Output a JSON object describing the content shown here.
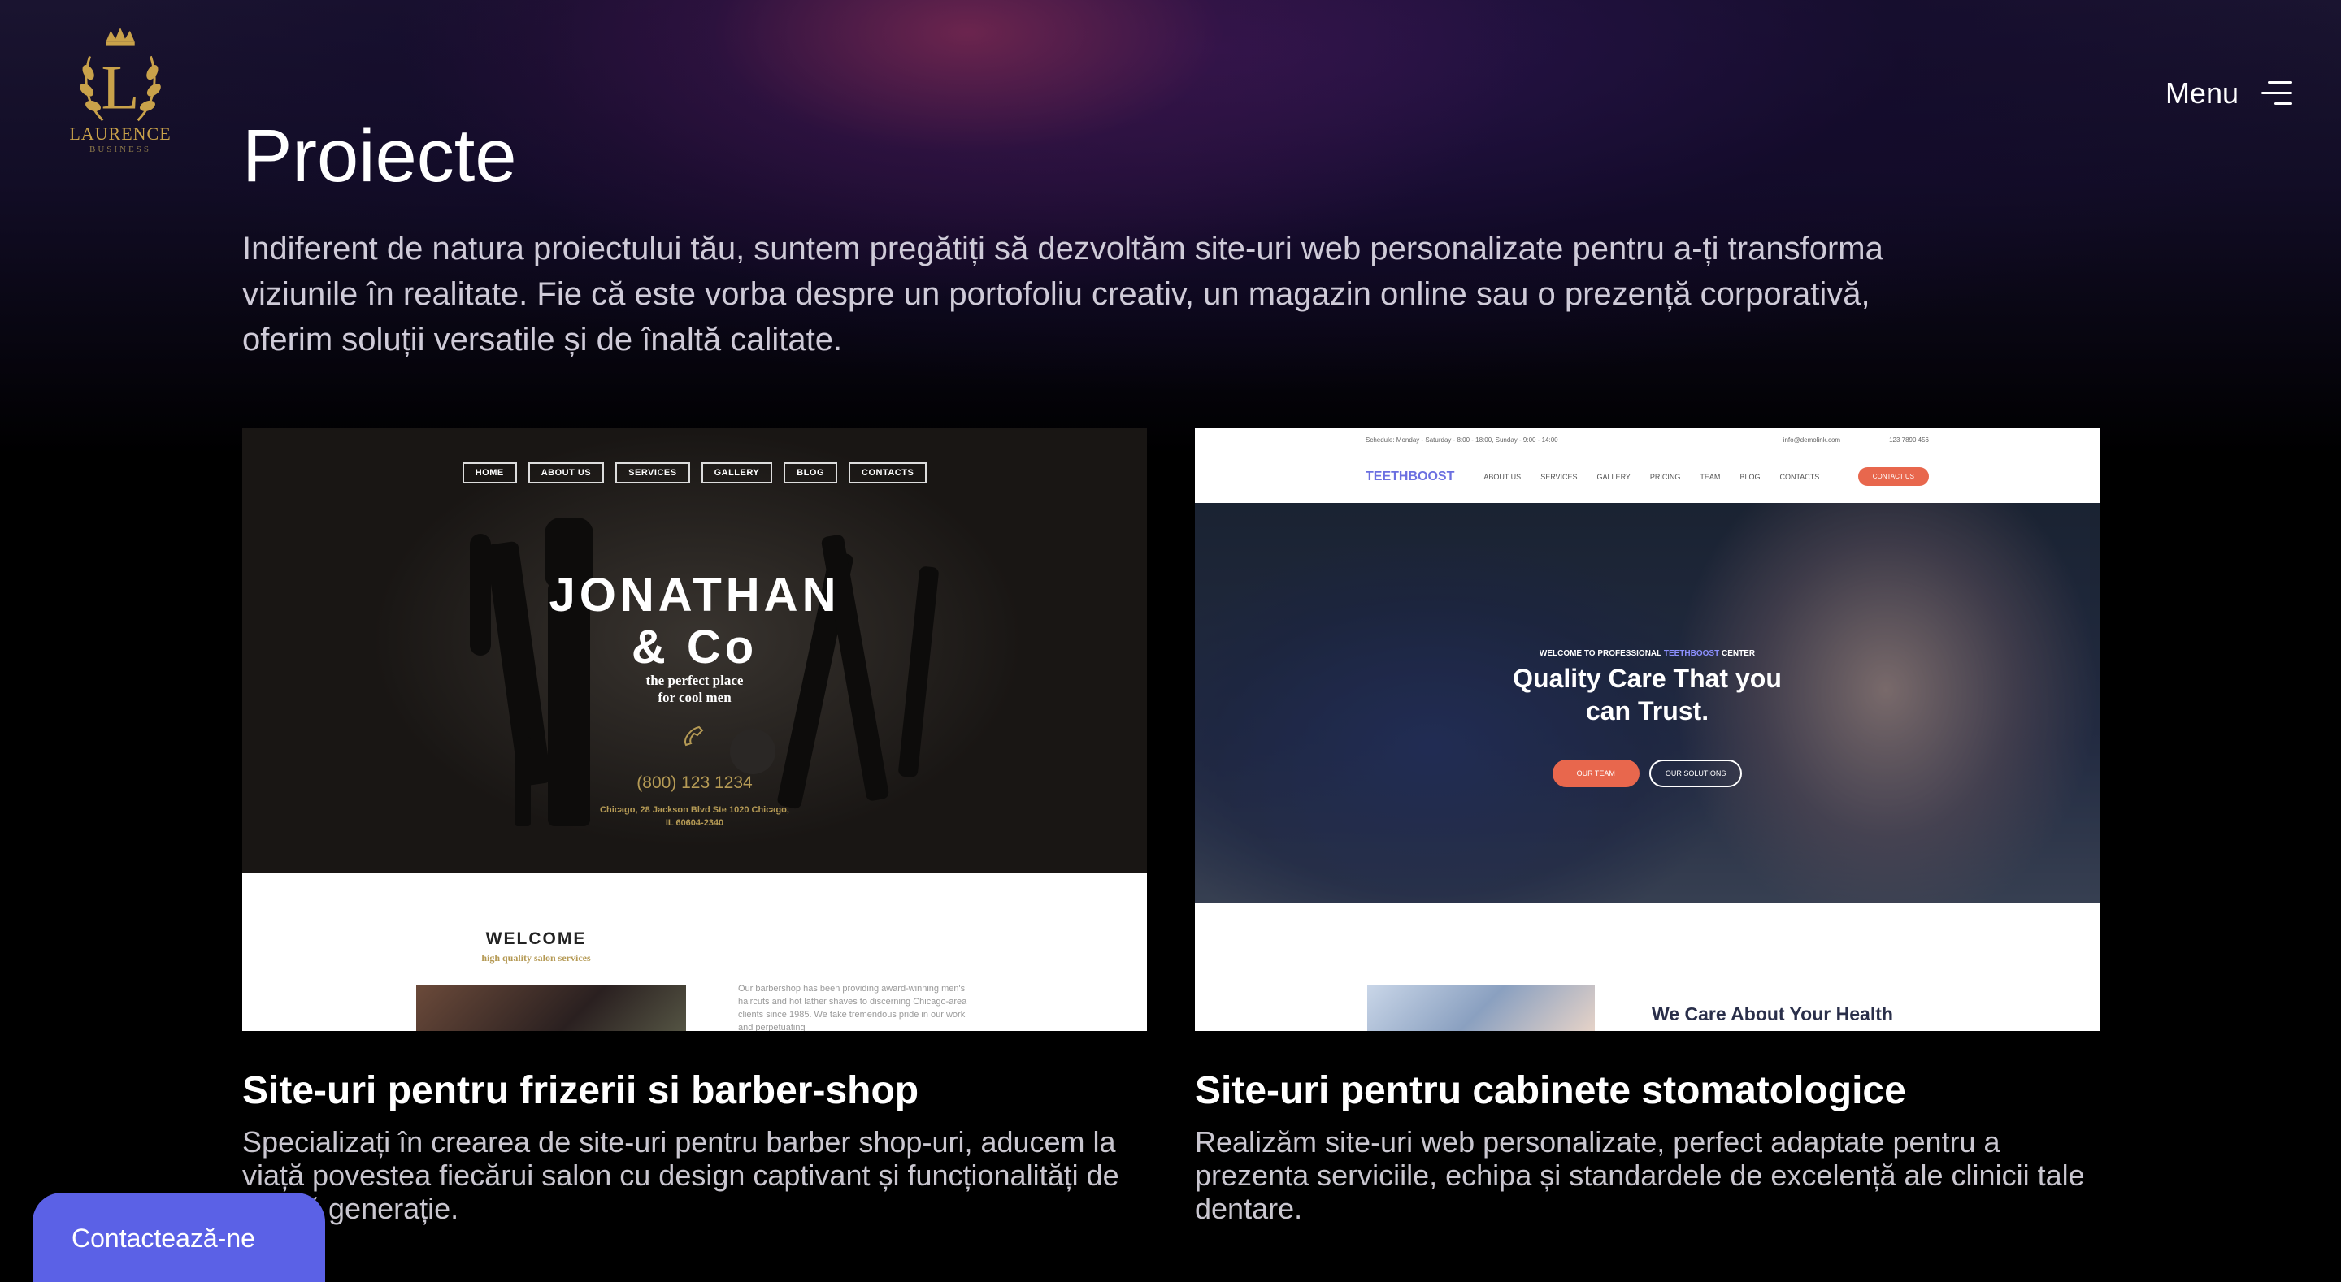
{
  "brand": {
    "logo_letter": "L",
    "logo_name": "LAURENCE",
    "logo_sub": "BUSINESS"
  },
  "header": {
    "menu_label": "Menu",
    "menu_icon": "hamburger-menu-icon"
  },
  "page": {
    "title": "Proiecte",
    "intro": "Indiferent de natura proiectului tău, suntem pregătiți să dezvoltăm site-uri web personalizate pentru a-ți transforma viziunile în realitate. Fie că este vorba despre un portofoliu creativ, un magazin online sau o prezență corporativă, oferim soluții versatile și de înaltă calitate."
  },
  "projects": [
    {
      "title": "Site-uri pentru frizerii si barber-shop",
      "description": "Specializați în crearea de site-uri pentru barber shop-uri, aducem la viață povestea fiecărui salon cu design captivant și funcționalități de ultimă generație.",
      "preview": {
        "nav": [
          "HOME",
          "ABOUT US",
          "SERVICES",
          "GALLERY",
          "BLOG",
          "CONTACTS"
        ],
        "title_line1": "JONATHAN",
        "title_line2": "& Co",
        "tagline_line1": "the perfect place",
        "tagline_line2": "for cool men",
        "phone": "(800) 123 1234",
        "address_line1": "Chicago, 28 Jackson Blvd Ste 1020 Chicago,",
        "address_line2": "IL 60604-2340",
        "welcome": "WELCOME",
        "welcome_sub": "high quality salon services",
        "paragraph": "Our barbershop has been providing award-winning men's haircuts and hot lather shaves to discerning Chicago-area clients since 1985. We take tremendous pride in our work and perpetuating"
      }
    },
    {
      "title": "Site-uri pentru cabinete stomatologice",
      "description": "Realizăm site-uri web personalizate, perfect adaptate pentru a prezenta serviciile, echipa și standardele de excelență ale clinicii tale dentare.",
      "preview": {
        "schedule": "Schedule: Monday - Saturday - 8:00 - 18:00, Sunday - 9:00 - 14:00",
        "email": "info@demolink.com",
        "phone": "123 7890 456",
        "logo": "TEETHBOOST",
        "nav": [
          "ABOUT US",
          "SERVICES",
          "GALLERY",
          "PRICING",
          "TEAM",
          "BLOG",
          "CONTACTS"
        ],
        "contact_button": "CONTACT US",
        "welcome_pre": "WELCOME TO PROFESSIONAL ",
        "welcome_accent": "TEETHBOOST",
        "welcome_post": " CENTER",
        "headline_line1": "Quality Care That you",
        "headline_line2": "can Trust.",
        "btn_team": "OUR TEAM",
        "btn_solutions": "OUR SOLUTIONS",
        "care_title": "We Care About Your Health"
      }
    }
  ],
  "contact_button": "Contactează-ne",
  "colors": {
    "accent": "#5b61e6",
    "gold": "#c9a24a",
    "dental_orange": "#e8674d",
    "dental_blue": "#6b6fe0"
  }
}
